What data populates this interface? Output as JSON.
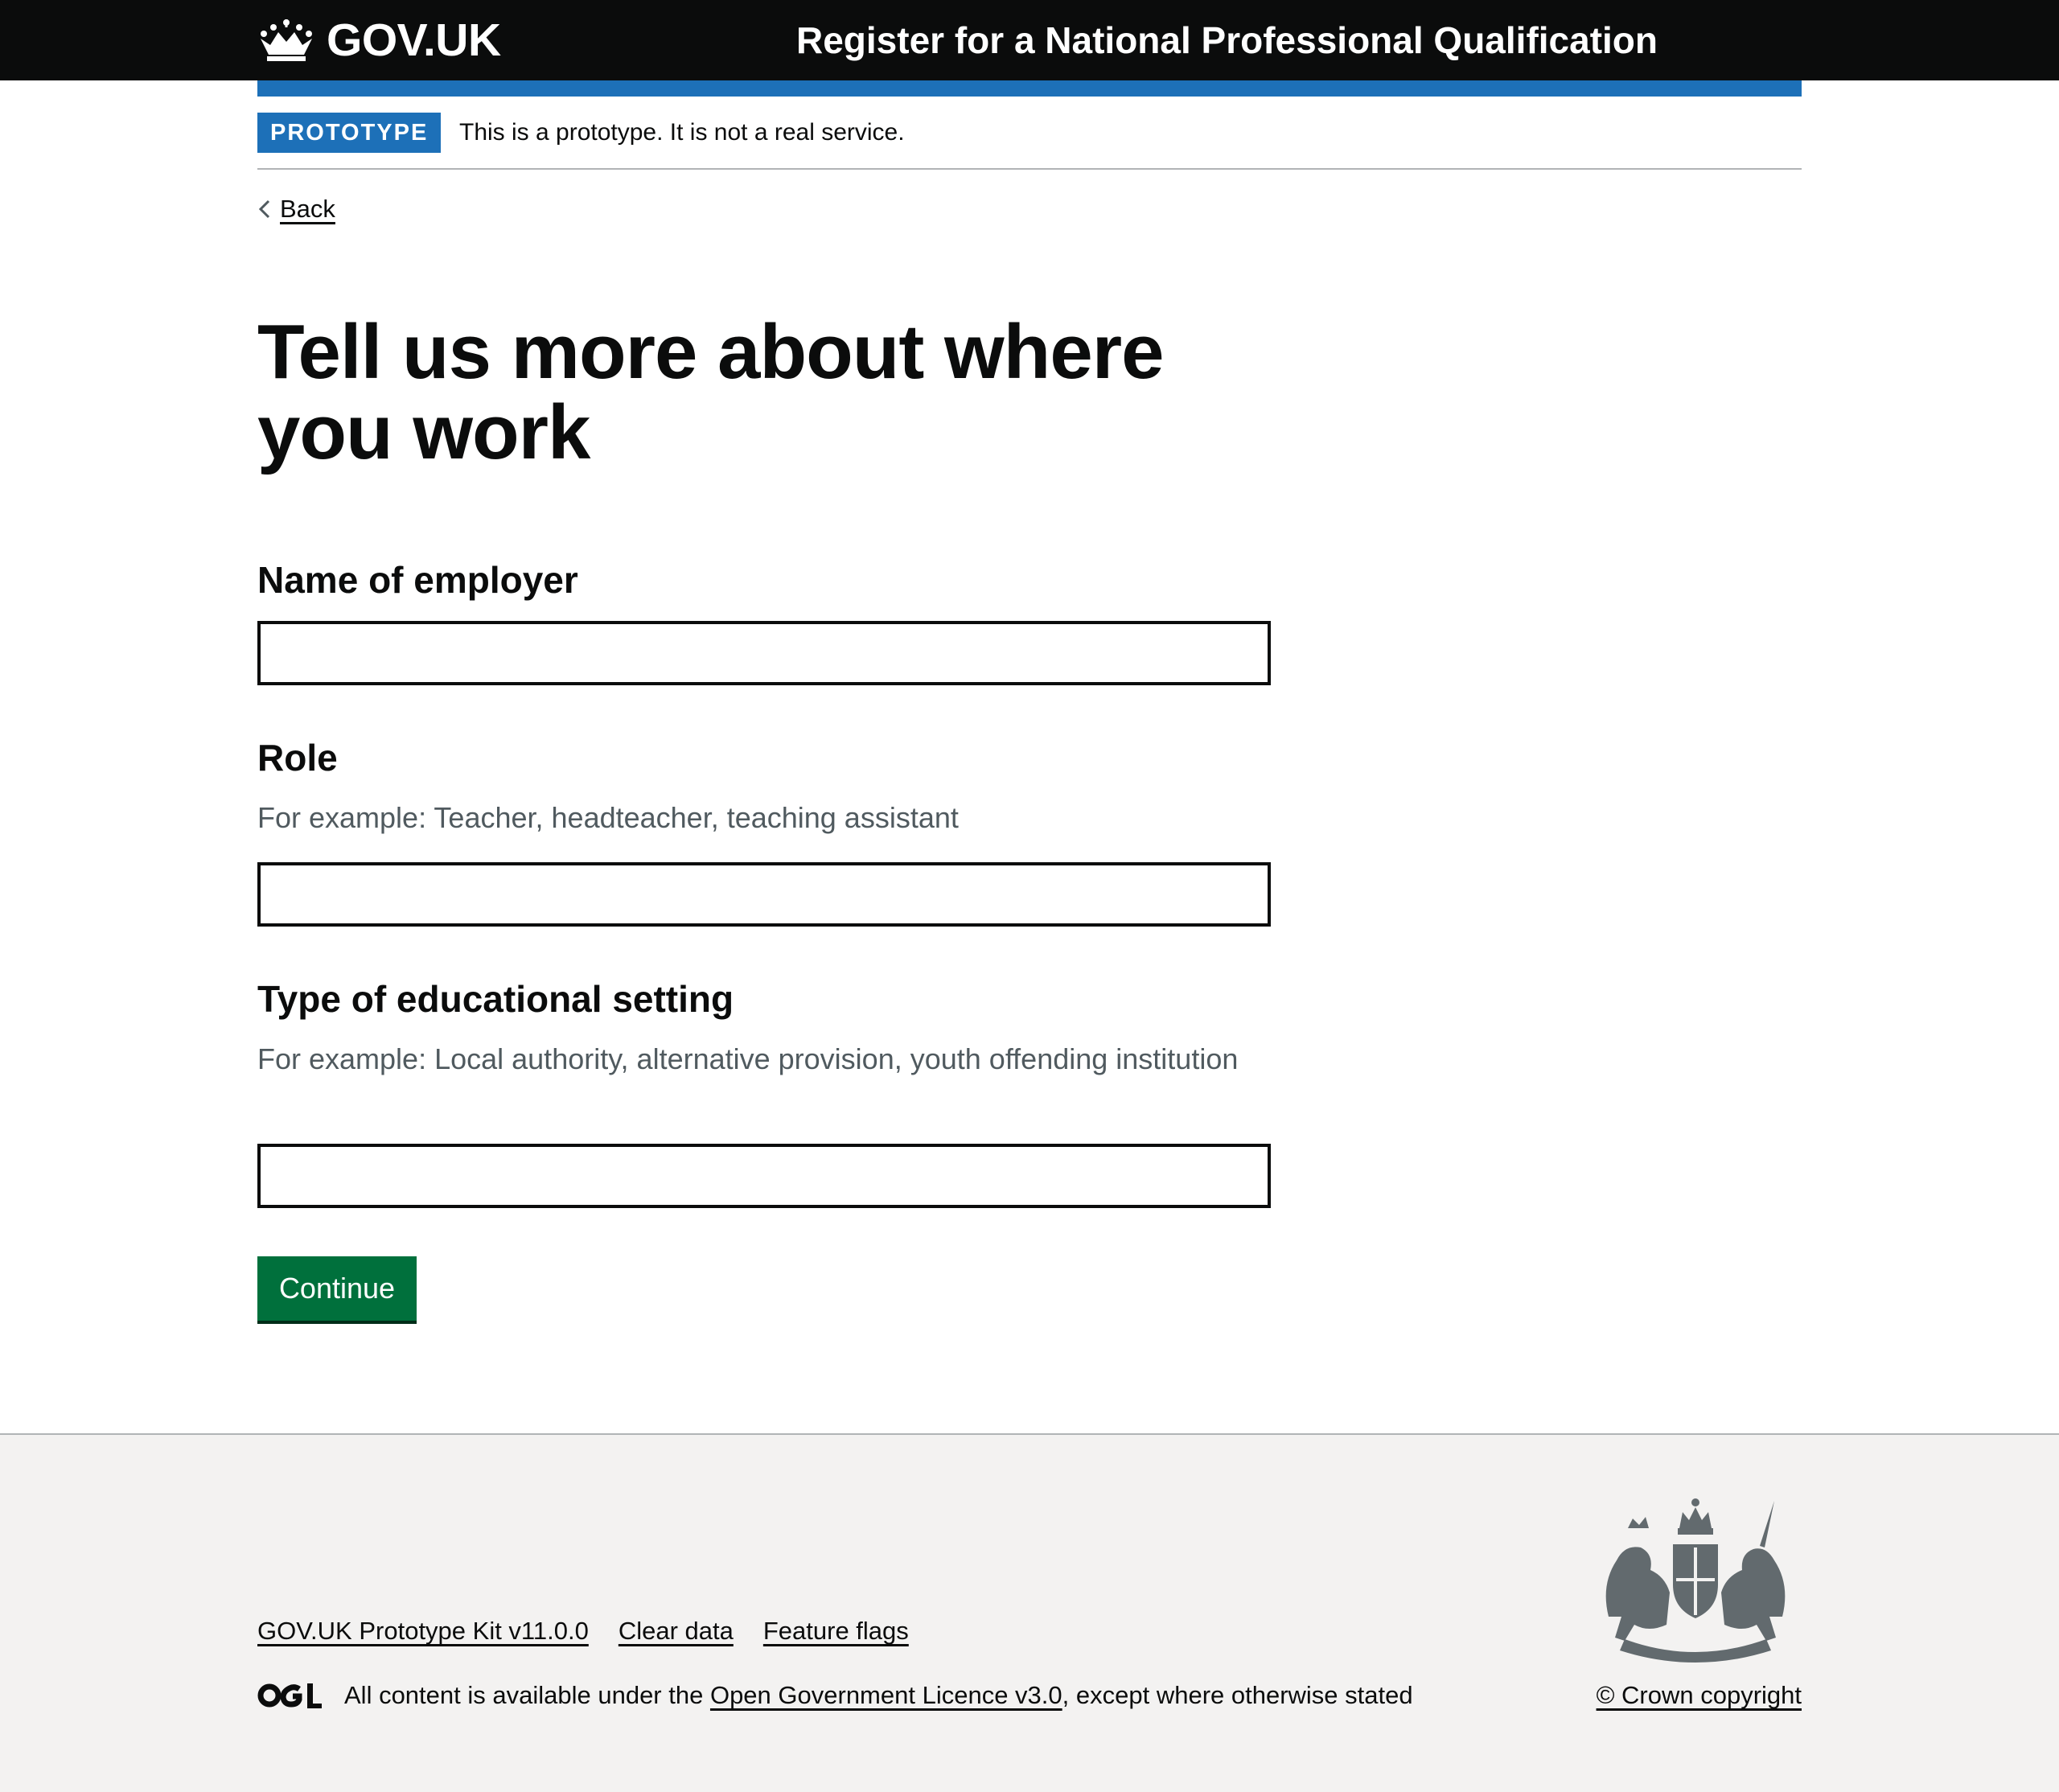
{
  "header": {
    "logo_text": "GOV.UK",
    "service_name": "Register for a National Professional Qualification"
  },
  "phase_banner": {
    "tag": "PROTOTYPE",
    "text": "This is a prototype. It is not a real service."
  },
  "back_link": "Back",
  "page_title": "Tell us more about where you work",
  "form": {
    "employer": {
      "label": "Name of employer",
      "value": ""
    },
    "role": {
      "label": "Role",
      "hint": "For example: Teacher, headteacher, teaching assistant",
      "value": ""
    },
    "setting": {
      "label": "Type of educational setting",
      "hint": "For example: Local authority, alternative provision, youth offending institution",
      "value": ""
    },
    "continue_label": "Continue"
  },
  "footer": {
    "links": [
      "GOV.UK Prototype Kit v11.0.0",
      "Clear data",
      "Feature flags"
    ],
    "licence_prefix": "All content is available under the ",
    "licence_link": "Open Government Licence v3.0",
    "licence_suffix": ", except where otherwise stated",
    "copyright": "© Crown copyright"
  },
  "colors": {
    "header_bg": "#0b0c0c",
    "brand_blue": "#1d70b8",
    "button_green": "#00703c",
    "footer_bg": "#f3f2f1",
    "hint_text": "#505a5f"
  },
  "icons": [
    "crown-icon",
    "chevron-left-icon",
    "ogl-logo-icon",
    "royal-coat-of-arms-icon"
  ]
}
